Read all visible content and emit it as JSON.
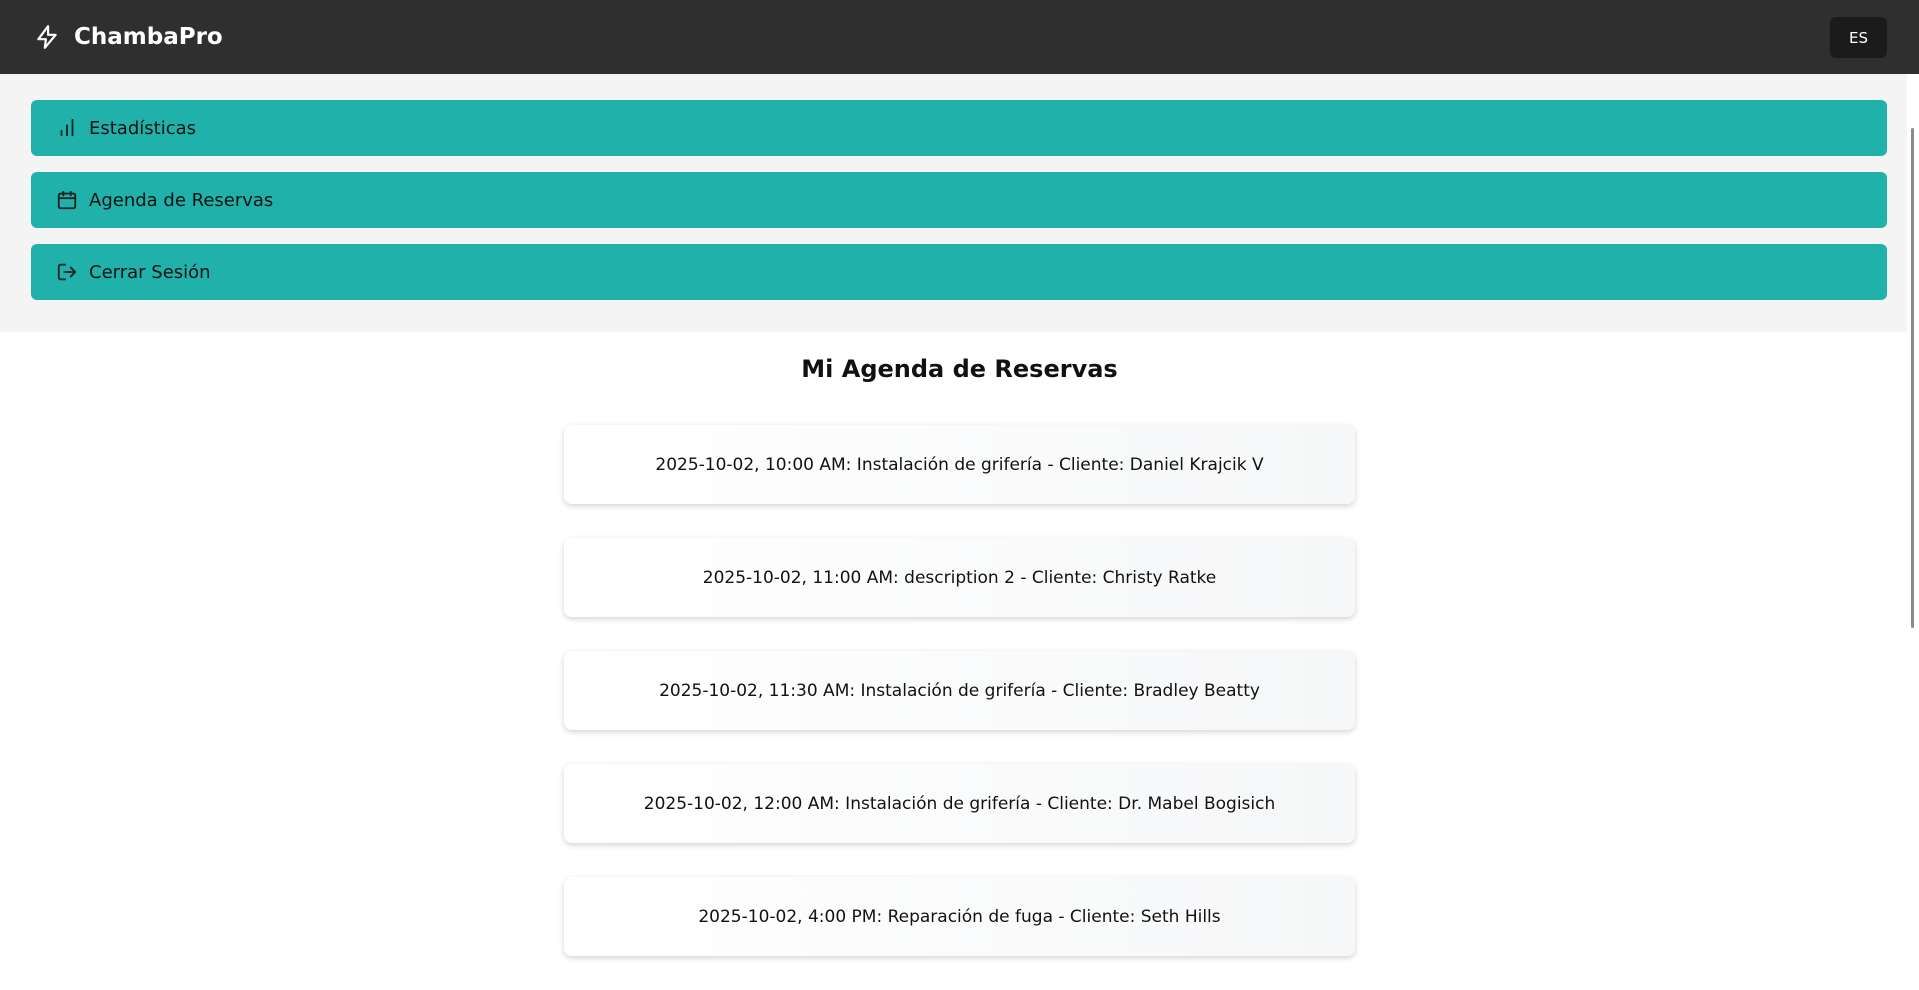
{
  "header": {
    "brand_icon": "bolt-icon",
    "brand_name": "ChambaPro",
    "language": "ES"
  },
  "menu": {
    "items": [
      {
        "icon": "bar-chart-icon",
        "label": "Estadísticas"
      },
      {
        "icon": "calendar-icon",
        "label": "Agenda de Reservas"
      },
      {
        "icon": "logout-icon",
        "label": "Cerrar Sesión"
      }
    ]
  },
  "colors": {
    "topbar": "#2f2f2f",
    "menu_button": "#20b2aa",
    "menu_background": "#f4f4f4"
  },
  "main": {
    "title": "Mi Agenda de Reservas",
    "bookings": [
      "2025-10-02, 10:00 AM: Instalación de grifería - Cliente: Daniel Krajcik V",
      "2025-10-02, 11:00 AM: description 2 - Cliente: Christy Ratke",
      "2025-10-02, 11:30 AM: Instalación de grifería - Cliente: Bradley Beatty",
      "2025-10-02, 12:00 AM: Instalación de grifería - Cliente: Dr. Mabel Bogisich",
      "2025-10-02, 4:00 PM: Reparación de fuga - Cliente: Seth Hills"
    ]
  }
}
